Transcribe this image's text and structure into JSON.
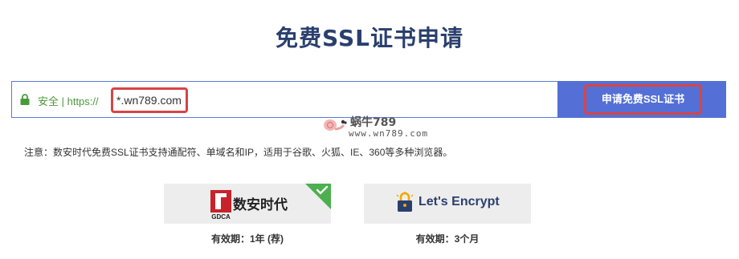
{
  "page_title": "免费SSL证书申请",
  "url_bar": {
    "secure_label": "安全 | https://",
    "domain_value": "*.wn789.com",
    "lock_icon": "lock-icon",
    "secure_color": "#4a9a3c"
  },
  "apply_button": {
    "label": "申请免费SSL证书",
    "background": "#5470d6",
    "highlight_border": "#d64545"
  },
  "watermark": {
    "name": "蜗牛789",
    "url": "www.wn789.com"
  },
  "notice": "注意：数安时代免费SSL证书支持通配符、单域名和IP，适用于谷歌、火狐、IE、360等多种浏览器。",
  "ca_options": [
    {
      "logo_text": "GDCA",
      "name": "数安时代",
      "validity": "有效期：1年 (荐)",
      "selected": true,
      "check_color": "#4caf50"
    },
    {
      "name": "Let's Encrypt",
      "validity": "有效期：3个月",
      "selected": false,
      "logo_color": "#f2a900"
    }
  ]
}
